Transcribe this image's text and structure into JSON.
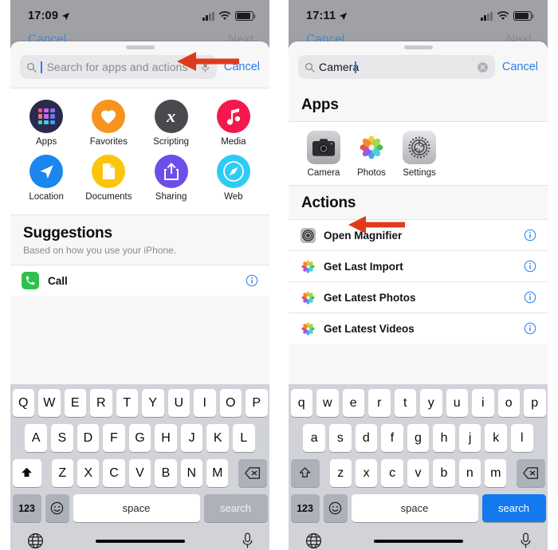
{
  "colors": {
    "accent_blue": "#2a7df0",
    "annotation_red": "#e03a1a",
    "statusbar_gray": "#a0a1a5",
    "keyboard_bg": "#d1d3d9",
    "enter_active_blue": "#1479ef"
  },
  "left_phone": {
    "status": {
      "time": "17:09",
      "location_arrow": "location-arrow",
      "signal": "signal-bars",
      "wifi": "wifi",
      "battery": "battery"
    },
    "behind_nav": {
      "cancel": "Cancel",
      "next": "Next"
    },
    "search": {
      "value": "",
      "placeholder": "Search for apps and actions",
      "cancel_label": "Cancel",
      "has_mic": true,
      "has_clear": false
    },
    "categories": [
      {
        "label": "Apps",
        "icon": "apps-grid-icon",
        "color": "#2a2a4e"
      },
      {
        "label": "Favorites",
        "icon": "heart-icon",
        "color": "#f7941e"
      },
      {
        "label": "Scripting",
        "icon": "scripting-x-icon",
        "color": "#4a4a4e"
      },
      {
        "label": "Media",
        "icon": "music-note-icon",
        "color": "#f5184f"
      },
      {
        "label": "Location",
        "icon": "location-arrow-icon",
        "color": "#1a86f0"
      },
      {
        "label": "Documents",
        "icon": "document-icon",
        "color": "#fcc40c"
      },
      {
        "label": "Sharing",
        "icon": "share-icon",
        "color": "#6d4ee8"
      },
      {
        "label": "Web",
        "icon": "compass-icon",
        "color": "#2ecbf5"
      }
    ],
    "suggestions": {
      "title": "Suggestions",
      "subtitle": "Based on how you use your iPhone.",
      "items": [
        {
          "label": "Call",
          "icon": "phone-icon",
          "info": "info-icon"
        }
      ]
    },
    "keyboard": {
      "row1": [
        "Q",
        "W",
        "E",
        "R",
        "T",
        "Y",
        "U",
        "I",
        "O",
        "P"
      ],
      "row2": [
        "A",
        "S",
        "D",
        "F",
        "G",
        "H",
        "J",
        "K",
        "L"
      ],
      "row3": [
        "Z",
        "X",
        "C",
        "V",
        "B",
        "N",
        "M"
      ],
      "shift_icon": "shift-filled-icon",
      "backspace_icon": "backspace-icon",
      "numbers_label": "123",
      "emoji_icon": "emoji-icon",
      "space_label": "space",
      "enter_label": "search",
      "enter_active": false,
      "globe_icon": "globe-icon",
      "mic_icon": "microphone-icon"
    }
  },
  "right_phone": {
    "status": {
      "time": "17:11",
      "location_arrow": "location-arrow",
      "signal": "signal-bars",
      "wifi": "wifi",
      "battery": "battery"
    },
    "behind_nav": {
      "cancel": "Cancel",
      "next": "Next"
    },
    "search": {
      "value": "Camera",
      "placeholder": "Search for apps and actions",
      "cancel_label": "Cancel",
      "has_mic": false,
      "has_clear": true
    },
    "apps_section": {
      "title": "Apps",
      "items": [
        {
          "label": "Camera",
          "icon": "camera-app-icon"
        },
        {
          "label": "Photos",
          "icon": "photos-app-icon"
        },
        {
          "label": "Settings",
          "icon": "settings-app-icon"
        }
      ]
    },
    "actions_section": {
      "title": "Actions",
      "items": [
        {
          "label": "Open Magnifier",
          "icon": "magnifier-app-icon",
          "info": "info-icon"
        },
        {
          "label": "Get Last Import",
          "icon": "photos-app-icon",
          "info": "info-icon"
        },
        {
          "label": "Get Latest Photos",
          "icon": "photos-app-icon",
          "info": "info-icon"
        },
        {
          "label": "Get Latest Videos",
          "icon": "photos-app-icon",
          "info": "info-icon"
        }
      ]
    },
    "keyboard": {
      "row1": [
        "q",
        "w",
        "e",
        "r",
        "t",
        "y",
        "u",
        "i",
        "o",
        "p"
      ],
      "row2": [
        "a",
        "s",
        "d",
        "f",
        "g",
        "h",
        "j",
        "k",
        "l"
      ],
      "row3": [
        "z",
        "x",
        "c",
        "v",
        "b",
        "n",
        "m"
      ],
      "shift_icon": "shift-outline-icon",
      "backspace_icon": "backspace-icon",
      "numbers_label": "123",
      "emoji_icon": "emoji-icon",
      "space_label": "space",
      "enter_label": "search",
      "enter_active": true,
      "globe_icon": "globe-icon",
      "mic_icon": "microphone-icon"
    }
  },
  "annotations": [
    {
      "name": "arrow-to-search-field",
      "direction": "left",
      "target": "search field"
    },
    {
      "name": "arrow-to-actions-heading",
      "direction": "left",
      "target": "Actions heading"
    }
  ]
}
